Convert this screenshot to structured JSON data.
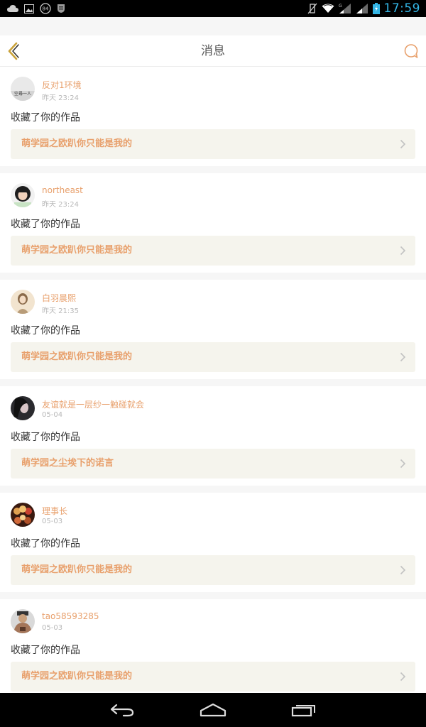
{
  "status_bar": {
    "time": "17:59",
    "left_icons": [
      "cloud-icon",
      "image-icon",
      "badge-84-icon",
      "shield-icon"
    ],
    "badge_number": "84",
    "right_icons": [
      "vibrate-icon",
      "wifi-icon",
      "signal-icon",
      "signal-2-icon",
      "battery-icon"
    ]
  },
  "header": {
    "title": "消息",
    "back_icon": "chevron-left-icon",
    "action_icon": "chat-bubble-icon"
  },
  "colors": {
    "accent": "#e8a06c",
    "back_icon": "#c9a23a",
    "work_link_bg": "#f5f4ed",
    "page_bg": "#f6f6f6"
  },
  "messages": [
    {
      "username": "反对1环境",
      "time": "昨天 23:24",
      "action": "收藏了你的作品",
      "work_title": "萌学园之欧趴你只能是我的",
      "avatar_icon": "avatar-text-icon",
      "avatar_text": "空尋一人"
    },
    {
      "username": "northeast",
      "time": "昨天 23:24",
      "action": "收藏了你的作品",
      "work_title": "萌学园之欧趴你只能是我的",
      "avatar_icon": "avatar-girl-icon"
    },
    {
      "username": "白羽晨熙",
      "time": "昨天 21:35",
      "action": "收藏了你的作品",
      "work_title": "萌学园之欧趴你只能是我的",
      "avatar_icon": "avatar-portrait-icon"
    },
    {
      "username": "友谊就是一层纱一触碰就会",
      "time": "05-04",
      "action": "收藏了你的作品",
      "work_title": "萌学园之尘埃下的诺言",
      "avatar_icon": "avatar-dark-icon"
    },
    {
      "username": "理事长",
      "time": "05-03",
      "action": "收藏了你的作品",
      "work_title": "萌学园之欧趴你只能是我的",
      "avatar_icon": "avatar-group-icon"
    },
    {
      "username": "tao58593285",
      "time": "05-03",
      "action": "收藏了你的作品",
      "work_title": "萌学园之欧趴你只能是我的",
      "avatar_icon": "avatar-man-icon"
    }
  ],
  "nav_bar": {
    "icons": [
      "back-nav-icon",
      "home-nav-icon",
      "recents-nav-icon"
    ]
  }
}
